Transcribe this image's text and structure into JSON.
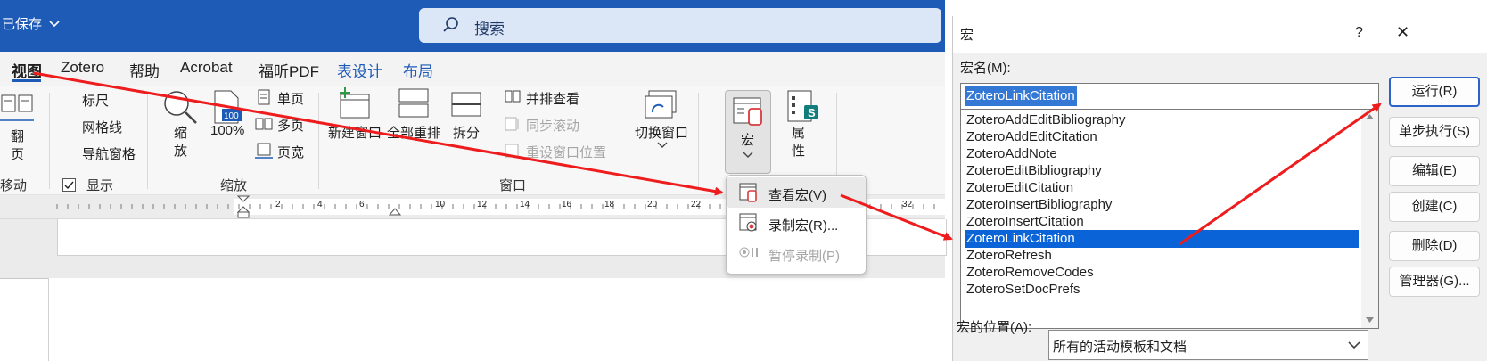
{
  "word": {
    "saved_status": "已保存",
    "search_placeholder": "搜索",
    "tabs": [
      {
        "label": "视图",
        "active": true
      },
      {
        "label": "Zotero"
      },
      {
        "label": "帮助"
      },
      {
        "label": "Acrobat"
      },
      {
        "label": "福昕PDF"
      },
      {
        "label": "表设计",
        "color": "blue"
      },
      {
        "label": "布局",
        "color": "blue"
      }
    ],
    "ribbon": {
      "page_move": {
        "button_line1": "翻",
        "button_line2": "页",
        "group": "移动"
      },
      "show": {
        "ruler": "标尺",
        "ruler_checked": true,
        "gridlines": "网格线",
        "gridlines_checked": false,
        "nav_pane": "导航窗格",
        "nav_pane_checked": false,
        "group": "显示"
      },
      "zoom": {
        "zoom_line1": "缩",
        "zoom_line2": "放",
        "hundred": "100%",
        "icon_text": "100",
        "one_page": "单页",
        "multi_page": "多页",
        "page_width": "页宽",
        "group": "缩放"
      },
      "window": {
        "new_window": "新建窗口",
        "arrange_all": "全部重排",
        "split": "拆分",
        "side_by_side": "并排查看",
        "sync_scroll": "同步滚动",
        "reset_position": "重设窗口位置",
        "switch_windows": "切换窗口",
        "group": "窗口"
      },
      "macros": {
        "label": "宏"
      },
      "properties": {
        "line1": "属",
        "line2": "性"
      }
    },
    "ruler_numbers": [
      "2",
      "4",
      "6",
      "10",
      "12",
      "14",
      "16",
      "18",
      "20",
      "22",
      "32"
    ],
    "macro_menu": [
      {
        "label": "查看宏(V)",
        "highlighted": true
      },
      {
        "label": "录制宏(R)..."
      },
      {
        "label": "暂停录制(P)",
        "disabled": true
      }
    ]
  },
  "dialog": {
    "title": "宏",
    "help": "?",
    "close": "✕",
    "macro_name_label": "宏名(M):",
    "macro_name_value": "ZoteroLinkCitation",
    "macro_list": [
      "ZoteroAddEditBibliography",
      "ZoteroAddEditCitation",
      "ZoteroAddNote",
      "ZoteroEditBibliography",
      "ZoteroEditCitation",
      "ZoteroInsertBibliography",
      "ZoteroInsertCitation",
      "ZoteroLinkCitation",
      "ZoteroRefresh",
      "ZoteroRemoveCodes",
      "ZoteroSetDocPrefs"
    ],
    "selected_macro": "ZoteroLinkCitation",
    "buttons": {
      "run": "运行(R)",
      "step_into": "单步执行(S)",
      "edit": "编辑(E)",
      "create": "创建(C)",
      "delete": "删除(D)",
      "organizer": "管理器(G)..."
    },
    "location_label": "宏的位置(A):",
    "location_value": "所有的活动模板和文档"
  },
  "colors": {
    "title_bar": "#1e5bb7",
    "accent_blue": "#1e5bb7",
    "selection": "#0a64d8",
    "annotation_arrow": "#ee1c1c"
  }
}
